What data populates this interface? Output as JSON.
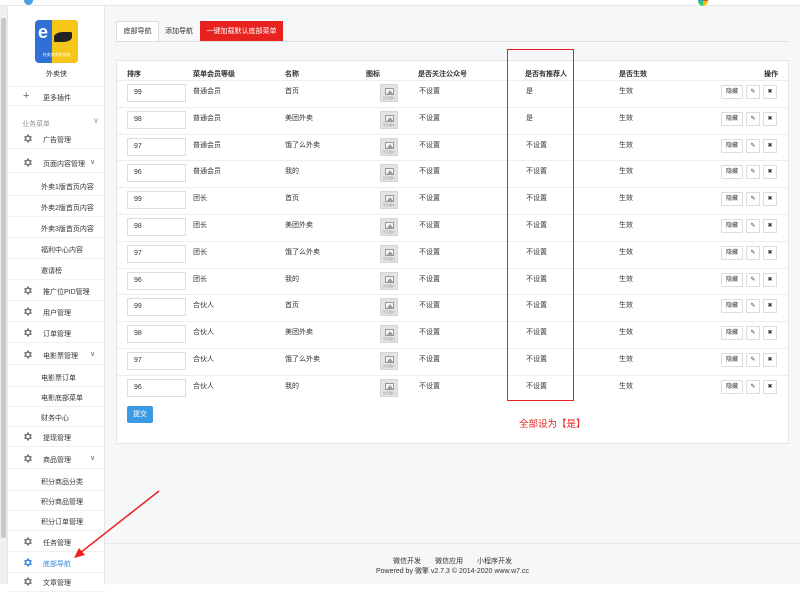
{
  "sidebar": {
    "brand_name": "外卖侠",
    "logo_caption": "外卖侠团购系统",
    "more_plugins": "更多插件",
    "group_title": "业务菜单",
    "items": [
      {
        "label": "广告管理",
        "type": "main"
      },
      {
        "label": "页面内容管理",
        "type": "main",
        "chevron": "∨"
      },
      {
        "label": "外卖1版首页内容",
        "type": "sub"
      },
      {
        "label": "外卖2版首页内容",
        "type": "sub"
      },
      {
        "label": "外卖3版首页内容",
        "type": "sub"
      },
      {
        "label": "福利中心内容",
        "type": "sub"
      },
      {
        "label": "邀请榜",
        "type": "sub"
      },
      {
        "label": "推广位PID管理",
        "type": "main"
      },
      {
        "label": "用户管理",
        "type": "main"
      },
      {
        "label": "订单管理",
        "type": "main"
      },
      {
        "label": "电影票管理",
        "type": "main",
        "chevron": "∨"
      },
      {
        "label": "电影票订单",
        "type": "sub"
      },
      {
        "label": "电影底部菜单",
        "type": "sub"
      },
      {
        "label": "财务中心",
        "type": "sub"
      },
      {
        "label": "提现管理",
        "type": "main"
      },
      {
        "label": "商品管理",
        "type": "main",
        "chevron": "∨"
      },
      {
        "label": "积分商品分类",
        "type": "sub"
      },
      {
        "label": "积分商品管理",
        "type": "sub"
      },
      {
        "label": "积分订单管理",
        "type": "sub"
      },
      {
        "label": "任务管理",
        "type": "main"
      },
      {
        "label": "底部导航",
        "type": "main",
        "active": true
      },
      {
        "label": "文章管理",
        "type": "main"
      }
    ]
  },
  "tabs": [
    {
      "label": "底部导航"
    },
    {
      "label": "添加导航"
    },
    {
      "label": "一键加载默认底部菜单"
    }
  ],
  "table": {
    "headers": [
      "排序",
      "菜单会员等级",
      "名称",
      "图标",
      "是否关注公众号",
      "是否有推荐人",
      "是否生效",
      "操作"
    ],
    "icon_text": "暂无图片",
    "actions": {
      "hide": "隐藏",
      "edit": "✎",
      "delete": "✖"
    },
    "rows": [
      {
        "sort": "99",
        "level": "普通会员",
        "name": "首页",
        "follow": "不设置",
        "referrer": "是",
        "active": "生效"
      },
      {
        "sort": "98",
        "level": "普通会员",
        "name": "美团外卖",
        "follow": "不设置",
        "referrer": "是",
        "active": "生效"
      },
      {
        "sort": "97",
        "level": "普通会员",
        "name": "饿了么外卖",
        "follow": "不设置",
        "referrer": "不设置",
        "active": "生效"
      },
      {
        "sort": "96",
        "level": "普通会员",
        "name": "我的",
        "follow": "不设置",
        "referrer": "不设置",
        "active": "生效"
      },
      {
        "sort": "99",
        "level": "团长",
        "name": "首页",
        "follow": "不设置",
        "referrer": "不设置",
        "active": "生效"
      },
      {
        "sort": "98",
        "level": "团长",
        "name": "美团外卖",
        "follow": "不设置",
        "referrer": "不设置",
        "active": "生效"
      },
      {
        "sort": "97",
        "level": "团长",
        "name": "饿了么外卖",
        "follow": "不设置",
        "referrer": "不设置",
        "active": "生效"
      },
      {
        "sort": "96",
        "level": "团长",
        "name": "我的",
        "follow": "不设置",
        "referrer": "不设置",
        "active": "生效"
      },
      {
        "sort": "99",
        "level": "合伙人",
        "name": "首页",
        "follow": "不设置",
        "referrer": "不设置",
        "active": "生效"
      },
      {
        "sort": "98",
        "level": "合伙人",
        "name": "美团外卖",
        "follow": "不设置",
        "referrer": "不设置",
        "active": "生效"
      },
      {
        "sort": "97",
        "level": "合伙人",
        "name": "饿了么外卖",
        "follow": "不设置",
        "referrer": "不设置",
        "active": "生效"
      },
      {
        "sort": "96",
        "level": "合伙人",
        "name": "我的",
        "follow": "不设置",
        "referrer": "不设置",
        "active": "生效"
      }
    ]
  },
  "submit_label": "提交",
  "annotation": "全部设为【是】",
  "footer": {
    "links": [
      "微信开发",
      "微信应用",
      "小程序开发"
    ],
    "powered": "Powered by 微擎 v2.7.3 © 2014-2020 www.w7.cc"
  },
  "colors": {
    "accent": "#3b86e0",
    "danger": "#e8231f",
    "submit": "#3b9ae1"
  }
}
